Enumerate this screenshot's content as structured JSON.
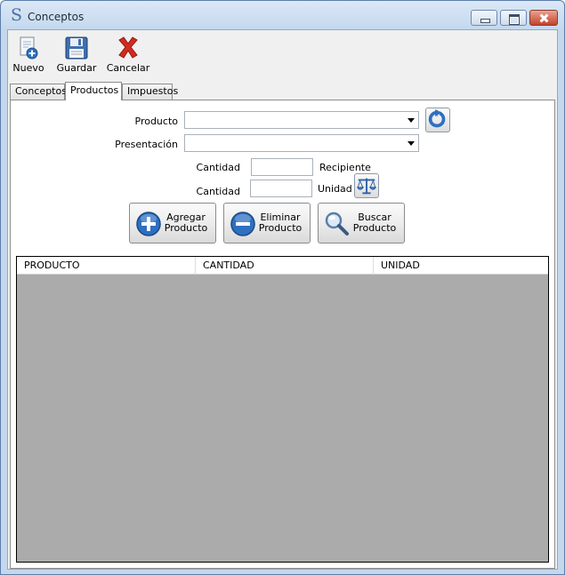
{
  "window": {
    "title": "Conceptos"
  },
  "toolbar": {
    "nuevo_label": "Nuevo",
    "guardar_label": "Guardar",
    "cancelar_label": "Cancelar"
  },
  "tabs": [
    {
      "label": "Conceptos",
      "active": false
    },
    {
      "label": "Productos",
      "active": true
    },
    {
      "label": "Impuestos",
      "active": false
    }
  ],
  "form": {
    "producto_label": "Producto",
    "producto_value": "",
    "presentacion_label": "Presentación",
    "presentacion_value": "",
    "cantidad_recipiente_label": "Cantidad",
    "cantidad_recipiente_value": "",
    "recipiente_label": "Recipiente",
    "cantidad_unidad_label": "Cantidad",
    "cantidad_unidad_value": "",
    "unidad_label": "Unidad"
  },
  "actions": {
    "agregar_label_1": "Agregar",
    "agregar_label_2": "Producto",
    "eliminar_label_1": "Eliminar",
    "eliminar_label_2": "Producto",
    "buscar_label_1": "Buscar",
    "buscar_label_2": "Producto"
  },
  "grid": {
    "columns": [
      "PRODUCTO",
      "CANTIDAD",
      "UNIDAD"
    ],
    "rows": []
  },
  "icons": {
    "app": "app-s-icon",
    "nuevo": "new-document-icon",
    "guardar": "floppy-disk-icon",
    "cancelar": "red-x-icon",
    "refresh": "refresh-icon",
    "scale": "balance-scale-icon",
    "agregar": "plus-circle-icon",
    "eliminar": "minus-circle-icon",
    "buscar": "magnifier-icon"
  },
  "colors": {
    "titlebar": "#c4d8ee",
    "grid_background": "#ababab",
    "accent_blue": "#2e6fc1",
    "cancel_red": "#d42a1f"
  }
}
